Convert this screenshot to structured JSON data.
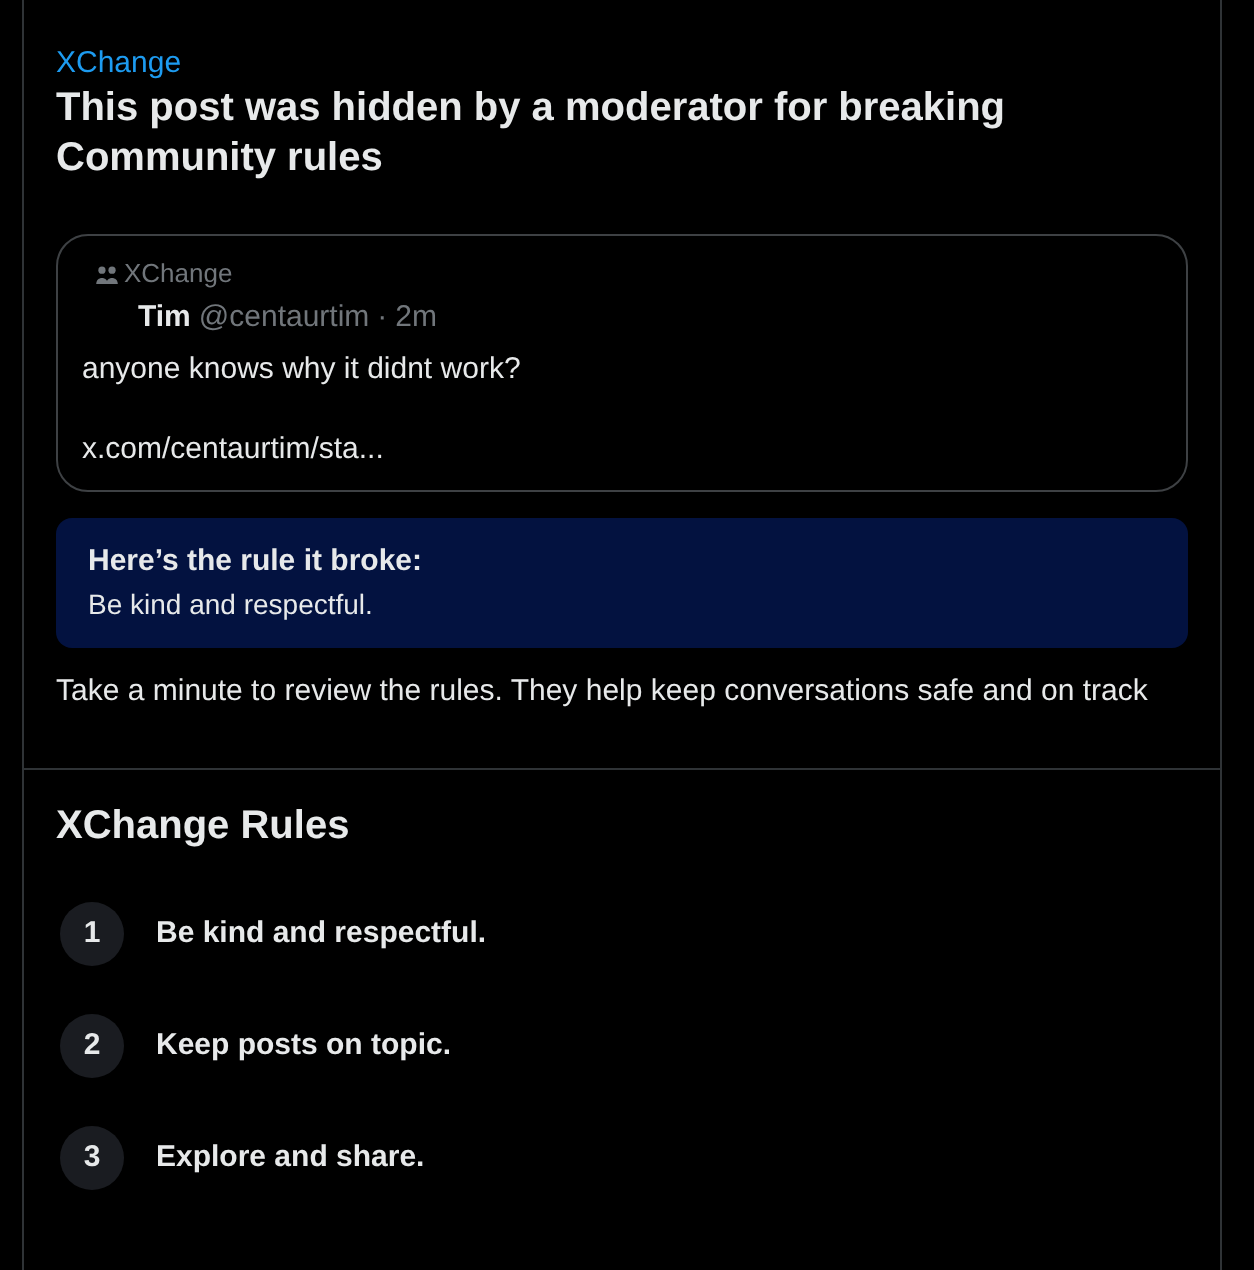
{
  "community_link": "XChange",
  "title": "This post was hidden by a moderator for breaking Community rules",
  "quoted_post": {
    "community": "XChange",
    "author": "Tim",
    "handle": "@centaurtim",
    "separator": "·",
    "time": "2m",
    "lines": [
      "anyone knows why it didnt work?",
      "x.com/centaurtim/sta..."
    ]
  },
  "broken_rule": {
    "heading": "Here’s the rule it broke:",
    "rule": "Be kind and respectful."
  },
  "advice": "Take a minute to review the rules. They help keep conversations safe and on track",
  "rules_section": {
    "title": "XChange Rules",
    "rules": [
      {
        "number": "1",
        "text": "Be kind and respectful."
      },
      {
        "number": "2",
        "text": "Keep posts on topic."
      },
      {
        "number": "3",
        "text": "Explore and share."
      }
    ]
  }
}
